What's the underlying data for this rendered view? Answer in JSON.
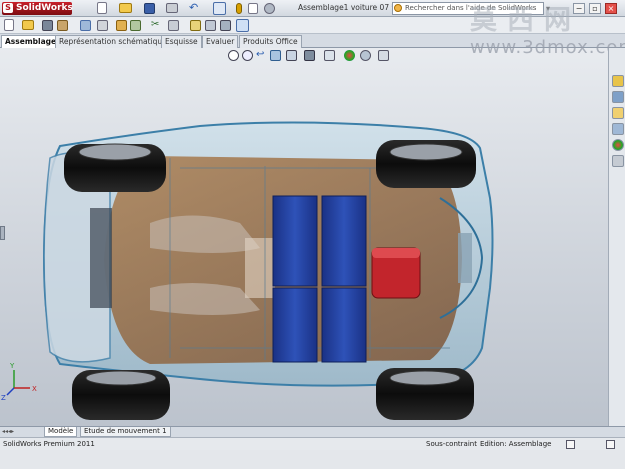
{
  "app": {
    "logo_text": "SolidWorks",
    "logo_mark": "S"
  },
  "window": {
    "title": "Assemblage1 voiture 07 *"
  },
  "search": {
    "placeholder": "Rechercher dans l'aide de SolidWorks"
  },
  "window_controls": {
    "minimize": "−",
    "restore": "▫",
    "close": "×"
  },
  "tabs": [
    {
      "label": "Assemblage"
    },
    {
      "label": "Représentation schématique"
    },
    {
      "label": "Esquisse"
    },
    {
      "label": "Evaluer"
    },
    {
      "label": "Produits Office"
    }
  ],
  "bottom_tabs": [
    {
      "label": "Modèle"
    },
    {
      "label": "Etude de mouvement 1"
    }
  ],
  "status": {
    "product": "SolidWorks Premium 2011",
    "constraint": "Sous-contraint",
    "edit_mode": "Edition: Assemblage"
  },
  "watermark": {
    "chinese": "莫西网",
    "url": "www.3dmox.com"
  },
  "triad": {
    "x": "X",
    "y": "Y",
    "z": "Z"
  },
  "colors": {
    "brand": "#b3161e",
    "battery_blue": "#1f3f9a",
    "battery_red": "#c2252c",
    "wheel": "#121212"
  },
  "icons": {
    "toolbar_row1": [
      "new-icon",
      "open-icon",
      "save-icon",
      "print-icon",
      "undo-icon",
      "select-icon",
      "rebuild-icon",
      "file-props-icon",
      "options-icon"
    ],
    "headsup": [
      "zoom-fit-icon",
      "zoom-area-icon",
      "previous-view-icon",
      "section-view-icon",
      "view-orientation-icon",
      "display-style-icon",
      "hide-show-icon",
      "edit-appearance-icon",
      "apply-scene-icon",
      "view-settings-icon"
    ],
    "task_pane": [
      "resources-icon",
      "design-library-icon",
      "file-explorer-icon",
      "view-palette-icon",
      "appearances-icon",
      "custom-props-icon"
    ]
  }
}
